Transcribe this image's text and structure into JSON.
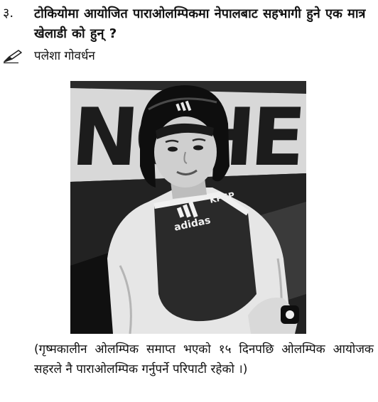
{
  "question": {
    "number": "३.",
    "text": "टोकियोमा आयोजित पाराओलम्पिकमा नेपालबाट सहभागी हुने एक मात्र खेलाडी को हुन् ?"
  },
  "answer": {
    "icon": "pencil-icon",
    "text": "पलेशा गोवर्धन"
  },
  "photo": {
    "background_lettering": "NCHE",
    "guard_brand": "adidas",
    "guard_label": "KPSP"
  },
  "caption": {
    "text": "(गृष्मकालीन ओलम्पिक समाप्त भएको १५ दिनपछि ओलम्पिक आयोजक सहरले नै पाराओलम्पिक गर्नुपर्ने परिपाटी रहेको ।)"
  }
}
